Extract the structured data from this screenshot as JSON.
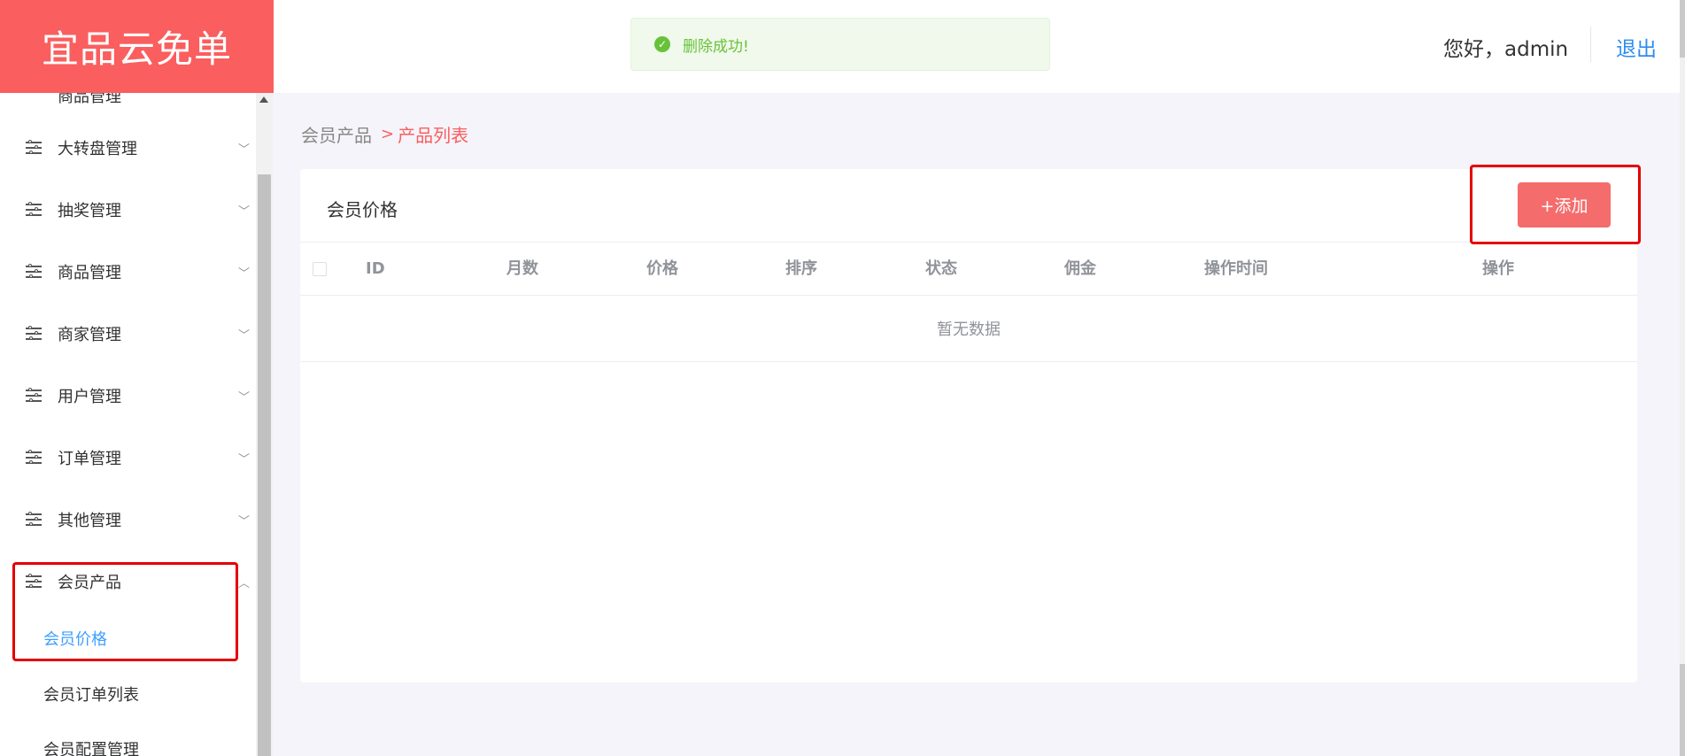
{
  "header": {
    "logo": "宜品云免单",
    "toast": "删除成功!",
    "greeting": "您好，admin",
    "logout": "退出"
  },
  "sidebar": {
    "cut_item": "商品管理",
    "items": [
      {
        "label": "大转盘管理"
      },
      {
        "label": "抽奖管理"
      },
      {
        "label": "商品管理"
      },
      {
        "label": "商家管理"
      },
      {
        "label": "用户管理"
      },
      {
        "label": "订单管理"
      },
      {
        "label": "其他管理"
      },
      {
        "label": "会员产品"
      }
    ],
    "sub_items": [
      {
        "label": "会员价格"
      },
      {
        "label": "会员订单列表"
      },
      {
        "label": "会员配置管理"
      }
    ]
  },
  "breadcrumb": {
    "parent": "会员产品",
    "current": "产品列表"
  },
  "card": {
    "title": "会员价格",
    "add_label": "+添加"
  },
  "table": {
    "columns": [
      "ID",
      "月数",
      "价格",
      "排序",
      "状态",
      "佣金",
      "操作时间",
      "操作"
    ],
    "empty_text": "暂无数据"
  },
  "colors": {
    "brand": "#fa5e5e",
    "add_button": "#f56c6c",
    "active_link": "#409eff",
    "success": "#67c23a",
    "highlight_box": "#e50000"
  },
  "icons": {
    "menu": "sliders-icon",
    "toast": "check-circle-icon",
    "collapse": "chevron-down-icon",
    "expand": "chevron-up-icon",
    "breadcrumb": "chevron-right-icon"
  }
}
